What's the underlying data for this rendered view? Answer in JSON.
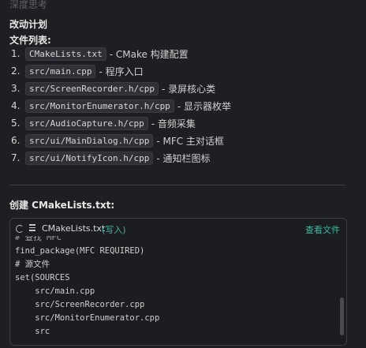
{
  "header": {
    "thinking_label": "深度思考"
  },
  "plan": {
    "title": "改动计划",
    "list_title": "文件列表:",
    "files": [
      {
        "num": "1.",
        "path": "CMakeLists.txt",
        "desc": "- CMake 构建配置"
      },
      {
        "num": "2.",
        "path": "src/main.cpp",
        "desc": "- 程序入口"
      },
      {
        "num": "3.",
        "path": "src/ScreenRecorder.h/cpp",
        "desc": "- 录屏核心类"
      },
      {
        "num": "4.",
        "path": "src/MonitorEnumerator.h/cpp",
        "desc": "- 显示器枚举"
      },
      {
        "num": "5.",
        "path": "src/AudioCapture.h/cpp",
        "desc": "- 音频采集"
      },
      {
        "num": "6.",
        "path": "src/ui/MainDialog.h/cpp",
        "desc": "- MFC 主对话框"
      },
      {
        "num": "7.",
        "path": "src/ui/NotifyIcon.h/cpp",
        "desc": "- 通知栏图标"
      }
    ]
  },
  "create": {
    "title": "创建 CMakeLists.txt:",
    "file_name": "CMakeLists.txt",
    "file_status": "(写入)",
    "view_label": "查看文件",
    "code_lines": [
      "# 查找 MFC",
      "find_package(MFC REQUIRED)",
      "# 源文件",
      "set(SOURCES",
      "    src/main.cpp",
      "    src/ScreenRecorder.cpp",
      "    src/MonitorEnumerator.cpp",
      "    src"
    ]
  }
}
